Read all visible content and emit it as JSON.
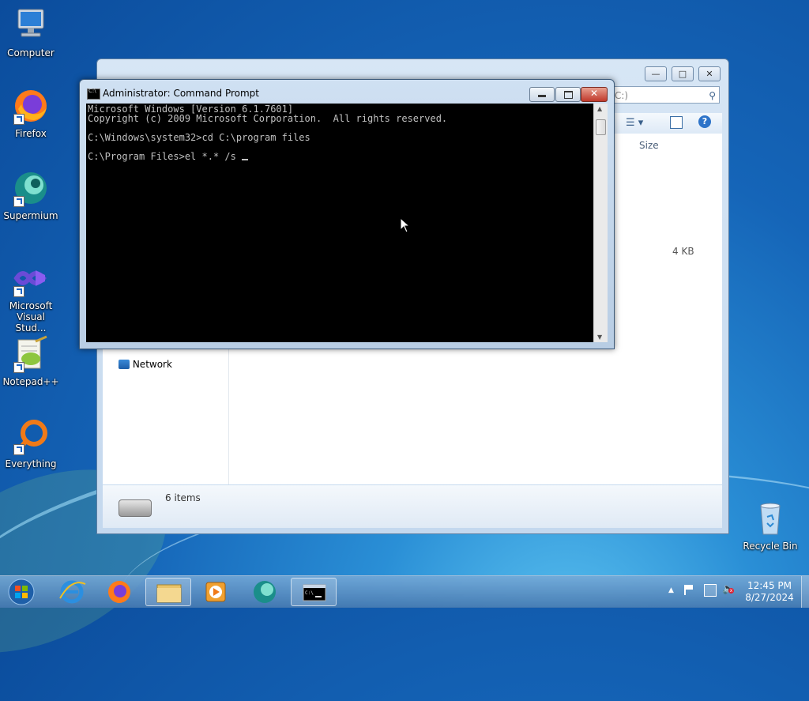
{
  "desktop": {
    "icons": [
      {
        "label": "Computer"
      },
      {
        "label": "Firefox"
      },
      {
        "label": "Supermium"
      },
      {
        "label": "Microsoft Visual Stud..."
      },
      {
        "label": "Notepad++"
      },
      {
        "label": "Everything"
      },
      {
        "label": "Recycle Bin"
      }
    ]
  },
  "explorer": {
    "search_placeholder": "C:)",
    "column_size": "Size",
    "row_size": "4 KB",
    "nav_network": "Network",
    "status_items": "6 items"
  },
  "cmd": {
    "title": "Administrator: Command Prompt",
    "lines": [
      "Microsoft Windows [Version 6.1.7601]",
      "Copyright (c) 2009 Microsoft Corporation.  All rights reserved.",
      "",
      "C:\\Windows\\system32>cd C:\\program files",
      "",
      "C:\\Program Files>el *.* /s "
    ]
  },
  "taskbar": {
    "apps": [
      "start",
      "internet-explorer",
      "firefox",
      "file-explorer",
      "media-player",
      "supermium",
      "command-prompt"
    ],
    "clock_time": "12:45 PM",
    "clock_date": "8/27/2024"
  },
  "colors": {
    "console_bg": "#000000",
    "console_fg": "#c0c0c0",
    "desktop_blue": "#1565b8"
  }
}
